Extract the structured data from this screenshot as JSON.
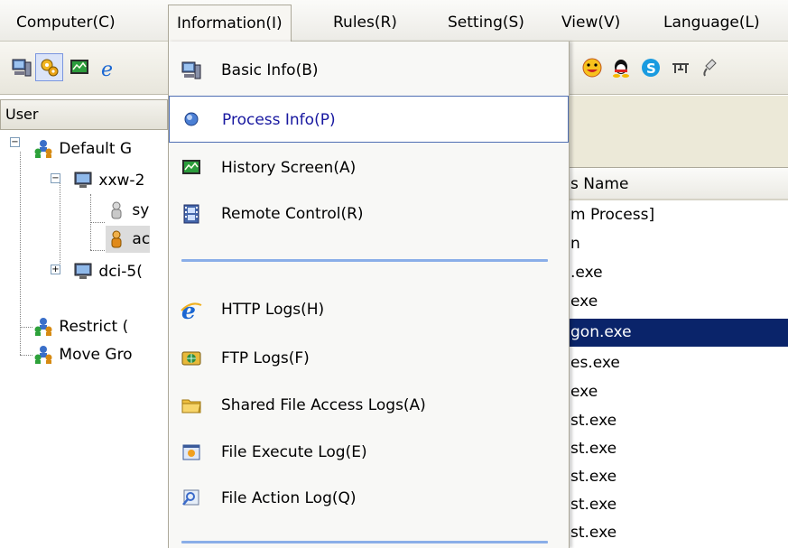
{
  "menubar": {
    "items": [
      {
        "label": "Computer(C)"
      },
      {
        "label": "Information(I)"
      },
      {
        "label": "Rules(R)"
      },
      {
        "label": "Setting(S)"
      },
      {
        "label": "View(V)"
      },
      {
        "label": "Language(L)"
      }
    ]
  },
  "left_panel": {
    "header": "User",
    "tree": [
      {
        "label": "Default G"
      },
      {
        "label": "xxw-2"
      },
      {
        "label": "sy"
      },
      {
        "label": "ac"
      },
      {
        "label": "dci-5("
      },
      {
        "label": "Restrict ("
      },
      {
        "label": "Move Gro"
      }
    ]
  },
  "right_panel": {
    "column_header": "s Name",
    "rows": [
      {
        "name": "m Process]"
      },
      {
        "name": "n"
      },
      {
        "name": ".exe"
      },
      {
        "name": "exe"
      },
      {
        "name": "gon.exe",
        "selected": true
      },
      {
        "name": "es.exe"
      },
      {
        "name": "exe"
      },
      {
        "name": "st.exe"
      },
      {
        "name": "st.exe"
      },
      {
        "name": "st.exe"
      },
      {
        "name": "st.exe"
      },
      {
        "name": "st.exe"
      }
    ]
  },
  "dropdown": {
    "items": [
      {
        "label": "Basic Info(B)",
        "icon": "computer-icon"
      },
      {
        "label": "Process Info(P)",
        "icon": "process-icon",
        "highlighted": true
      },
      {
        "label": "History Screen(A)",
        "icon": "history-screen-icon"
      },
      {
        "label": "Remote Control(R)",
        "icon": "film-icon"
      },
      {
        "label": "HTTP Logs(H)",
        "icon": "ie-icon"
      },
      {
        "label": "FTP Logs(F)",
        "icon": "ftp-icon"
      },
      {
        "label": "Shared File Access Logs(A)",
        "icon": "shared-folder-icon"
      },
      {
        "label": "File Execute Log(E)",
        "icon": "file-execute-icon"
      },
      {
        "label": "File Action Log(Q)",
        "icon": "file-action-icon"
      }
    ]
  },
  "colors": {
    "selection": "#0a246a",
    "menu_highlight_text": "#1818a0",
    "separator": "#8aaee8"
  }
}
